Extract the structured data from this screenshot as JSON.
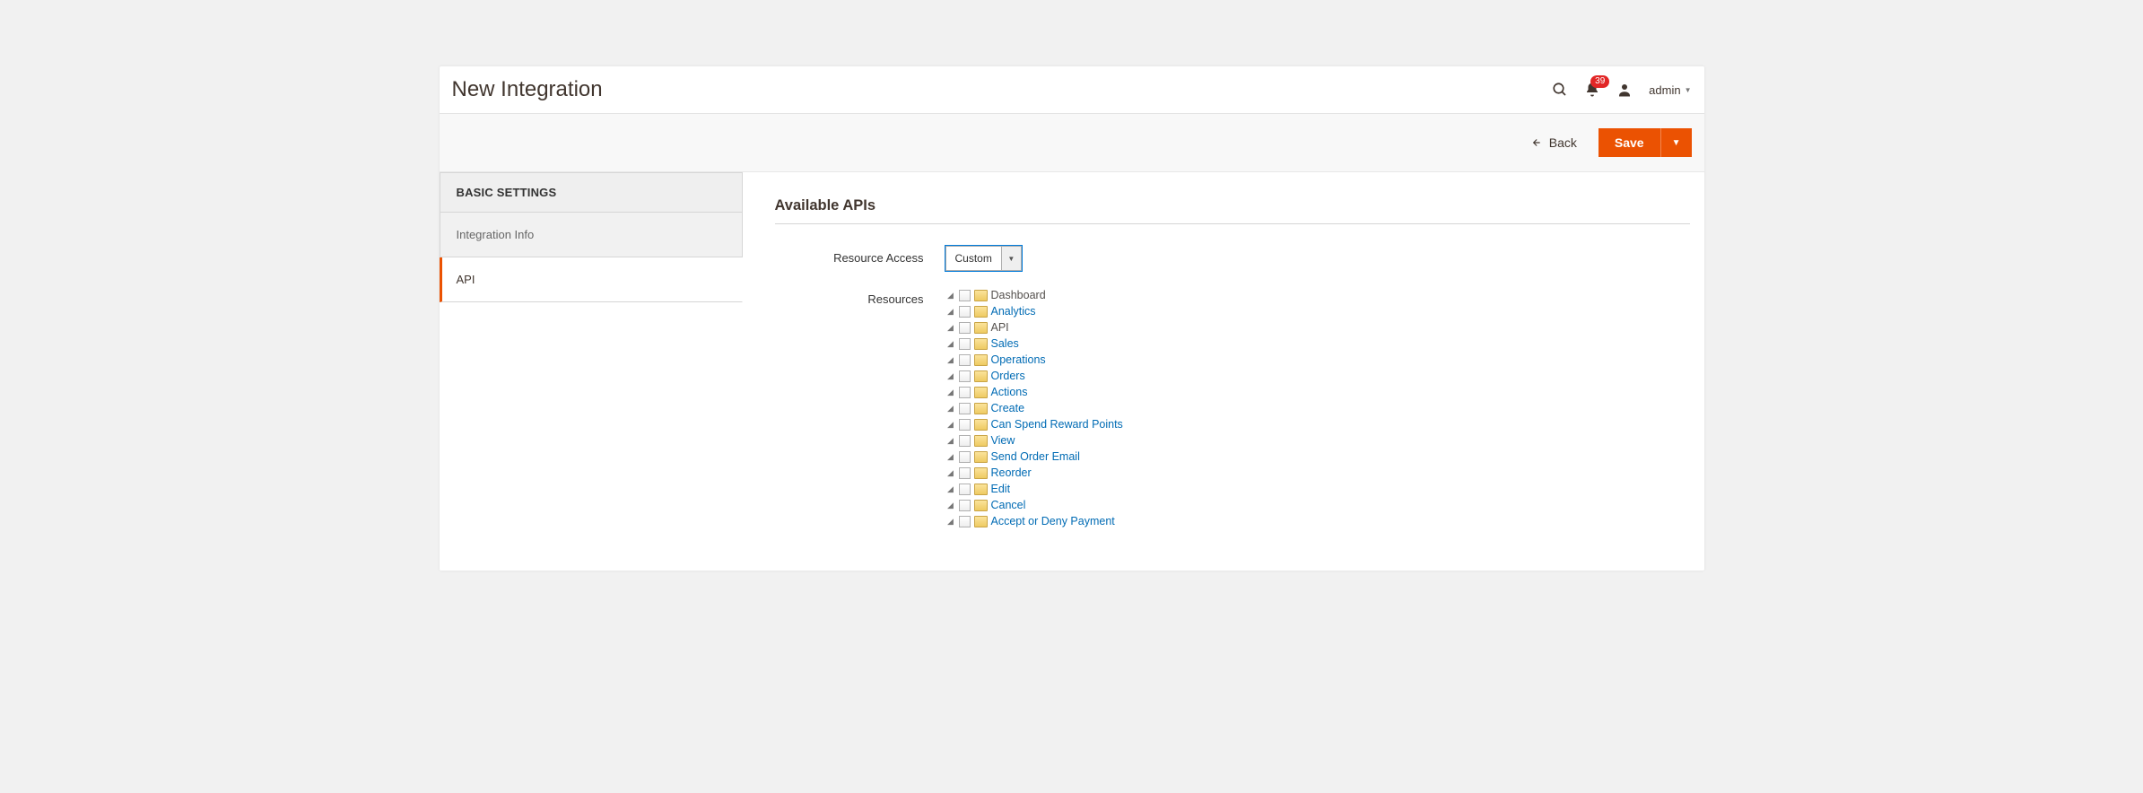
{
  "header": {
    "title": "New Integration",
    "notif_count": "39",
    "admin_label": "admin"
  },
  "actions": {
    "back": "Back",
    "save": "Save"
  },
  "sidebar": {
    "group_title": "BASIC SETTINGS",
    "items": [
      {
        "label": "Integration Info",
        "active": false
      },
      {
        "label": "API",
        "active": true
      }
    ]
  },
  "form": {
    "section_title": "Available APIs",
    "resource_access_label": "Resource Access",
    "resource_access_value": "Custom",
    "resources_label": "Resources"
  },
  "tree": {
    "dashboard": "Dashboard",
    "analytics": "Analytics",
    "api": "API",
    "sales": "Sales",
    "operations": "Operations",
    "orders": "Orders",
    "actions": "Actions",
    "create": "Create",
    "can_spend": "Can Spend Reward Points",
    "view": "View",
    "send_order_email": "Send Order Email",
    "reorder": "Reorder",
    "edit": "Edit",
    "cancel": "Cancel",
    "accept_deny": "Accept or Deny Payment"
  }
}
